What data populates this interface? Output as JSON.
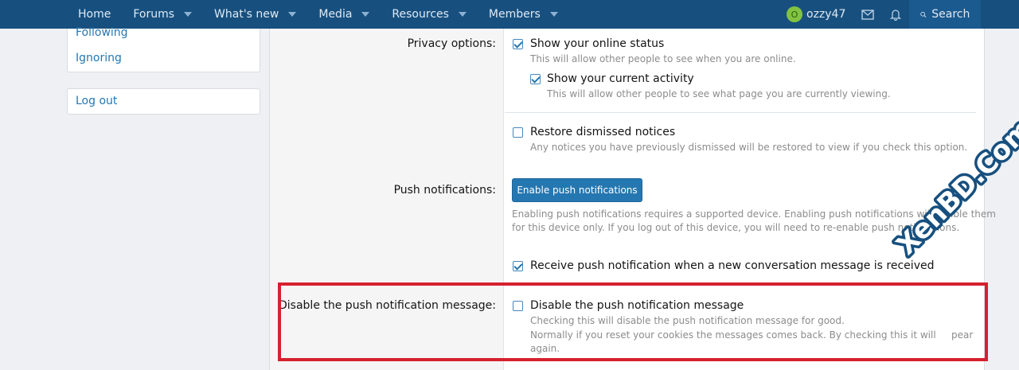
{
  "nav": {
    "tabs": [
      {
        "label": "Home",
        "has_menu": false
      },
      {
        "label": "Forums",
        "has_menu": true
      },
      {
        "label": "What's new",
        "has_menu": true
      },
      {
        "label": "Media",
        "has_menu": true
      },
      {
        "label": "Resources",
        "has_menu": true
      },
      {
        "label": "Members",
        "has_menu": true
      }
    ],
    "user": {
      "avatar_letter": "O",
      "name": "ozzy47"
    },
    "search_label": "Search",
    "colors": {
      "bar": "#17507f",
      "text": "#dfe9f3"
    }
  },
  "sidebar": {
    "following": "Following",
    "ignoring": "Ignoring",
    "logout": "Log out"
  },
  "form": {
    "privacy_label": "Privacy options:",
    "online_status": {
      "label": "Show your online status",
      "hint": "This will allow other people to see when you are online.",
      "checked": true
    },
    "current_activity": {
      "label": "Show your current activity",
      "hint": "This will allow other people to see what page you are currently viewing.",
      "checked": true
    },
    "restore_notices": {
      "label": "Restore dismissed notices",
      "hint": "Any notices you have previously dismissed will be restored to view if you check this option.",
      "checked": false
    },
    "push_label": "Push notifications:",
    "push_button": "Enable push notifications",
    "push_hint_1": "Enabling push notifications requires a supported device. Enabling push notifications will enable them",
    "push_hint_2": "for this device only. If you log out of this device, you will need to re-enable push notifications.",
    "receive_push": {
      "label": "Receive push notification when a new conversation message is received",
      "checked": true
    },
    "disable_label": "Disable the push notification message:",
    "disable_push": {
      "label": "Disable the push notification message",
      "hint_1": "Checking this will disable the push notification message for good.",
      "hint_2": "Normally if you reset your cookies the messages comes back. By checking this it will",
      "hint_2b": "pear",
      "hint_3": "again.",
      "checked": false
    }
  },
  "watermark": {
    "text": "XenBD.Com",
    "color": "#17507f"
  }
}
